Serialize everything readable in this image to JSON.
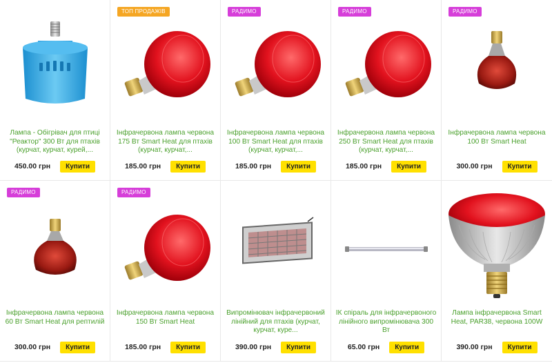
{
  "products": [
    {
      "badge": "",
      "title": "Лампа - Обігрівач для птиці \"Реактор\" 300 Вт для птахів (курчат, курчат, курей,...",
      "price": "450.00 грн",
      "button": "Купити"
    },
    {
      "badge": "ТОП ПРОДАЖІВ",
      "title": "Інфрачервона лампа червона 175 Вт Smart Heat для птахів (курчат, курчат,...",
      "price": "185.00 грн",
      "button": "Купити"
    },
    {
      "badge": "РАДИМО",
      "title": "Інфрачервона лампа червона 100 Вт Smart Heat для птахів (курчат, курчат,...",
      "price": "185.00 грн",
      "button": "Купити"
    },
    {
      "badge": "РАДИМО",
      "title": "Інфрачервона лампа червона 250 Вт Smart Heat для птахів (курчат, курчат,...",
      "price": "185.00 грн",
      "button": "Купити"
    },
    {
      "badge": "РАДИМО",
      "title": "Інфрачервона лампа червона 100 Вт Smart Heat",
      "price": "300.00 грн",
      "button": "Купити"
    },
    {
      "badge": "РАДИМО",
      "title": "Інфрачервона лампа червона 60 Вт Smart Heat для рептилій",
      "price": "300.00 грн",
      "button": "Купити"
    },
    {
      "badge": "РАДИМО",
      "title": "Інфрачервона лампа червона 150 Вт Smart Heat",
      "price": "185.00 грн",
      "button": "Купити"
    },
    {
      "badge": "",
      "title": "Випромінювач інфрачервоний лінійний для птахів (курчат, курчат, куре...",
      "price": "390.00 грн",
      "button": "Купити"
    },
    {
      "badge": "",
      "title": "ІК спіраль для інфрачервоного лінійного випромінювача 300 Вт",
      "price": "65.00 грн",
      "button": "Купити"
    },
    {
      "badge": "",
      "title": "Лампа інфрачервона Smart Heat, PAR38, червона 100W",
      "price": "390.00 грн",
      "button": "Купити"
    }
  ],
  "colors": {
    "title": "#4aa02c",
    "buy_button": "#ffe000",
    "badge_top": "#f5a623",
    "badge_radimo": "#d63ed9"
  }
}
